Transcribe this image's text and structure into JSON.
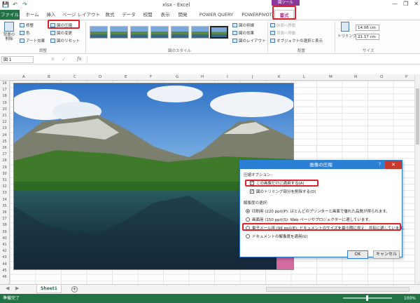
{
  "title": {
    "app_title": "xlsx - Excel",
    "context_title": "図ツール"
  },
  "qat": {
    "save": "💾",
    "undo": "↶",
    "redo": "↷"
  },
  "window": {
    "minimize": "—",
    "restore": "❐",
    "close": "✕"
  },
  "tabs": [
    {
      "label": "ファイル"
    },
    {
      "label": "ホーム"
    },
    {
      "label": "挿入"
    },
    {
      "label": "ページ レイアウト"
    },
    {
      "label": "数式"
    },
    {
      "label": "データ"
    },
    {
      "label": "校閲"
    },
    {
      "label": "表示"
    },
    {
      "label": "開発"
    },
    {
      "label": "POWER QUERY"
    },
    {
      "label": "POWERPIVOT"
    },
    {
      "label": "書式"
    }
  ],
  "ribbon": {
    "remove_bg": "背景の削除",
    "corrections": "修整",
    "color": "色",
    "artistic": "アート効果",
    "compress": "図の圧縮",
    "change": "図の変更",
    "reset": "図のリセット",
    "adjust_group": "調整",
    "border": "図の枠線",
    "effects": "図の効果",
    "layout": "図のレイアウト",
    "styles_group": "図のスタイル",
    "bring_forward": "前面へ移動",
    "send_backward": "背面へ移動",
    "selection_pane": "オブジェクトの選択と表示",
    "arrange_group": "配置",
    "crop": "トリミング",
    "height": "14.06 cm",
    "width": "21.17 cm",
    "size_group": "サイズ"
  },
  "formula_bar": {
    "name_box": "図 1",
    "fx": "fx"
  },
  "columns": [
    "A",
    "B",
    "C",
    "D",
    "E",
    "F",
    "G",
    "H",
    "I",
    "J",
    "K",
    "L",
    "M",
    "N",
    "O",
    "P"
  ],
  "rows": [
    "16",
    "17",
    "18",
    "19",
    "20",
    "21",
    "22",
    "23",
    "24",
    "25",
    "26",
    "27",
    "28",
    "29",
    "30",
    "31",
    "32",
    "33",
    "34",
    "35",
    "36",
    "37",
    "38",
    "39",
    "40",
    "41",
    "42",
    "43",
    "44",
    "45",
    "46"
  ],
  "dialog": {
    "title": "画像の圧縮",
    "help": "?",
    "close": "✕",
    "section_options": "圧縮オプション:",
    "opt_apply_selected": "この画像だけに適用する(A)",
    "opt_delete_cropped": "図のトリミング部分を削除する(D)",
    "section_resolution": "解像度の選択:",
    "res_print": "印刷用 (220 ppi)(P): ほとんどのプリンターと画面で優れた品質が得られます。",
    "res_screen": "画面用 (150 ppi)(S): Web ページやプロジェクターに適しています。",
    "res_email": "電子メール用 (96 ppi)(E): ドキュメントのサイズを最小限に抑え、共有に適しています。",
    "res_document": "ドキュメントの解像度を適用(U)",
    "ok": "OK",
    "cancel": "キャンセル"
  },
  "sheets": [
    {
      "label": "Sheet1"
    }
  ],
  "add_sheet": "+",
  "status": {
    "ready": "準備完了",
    "zoom": "100%"
  }
}
